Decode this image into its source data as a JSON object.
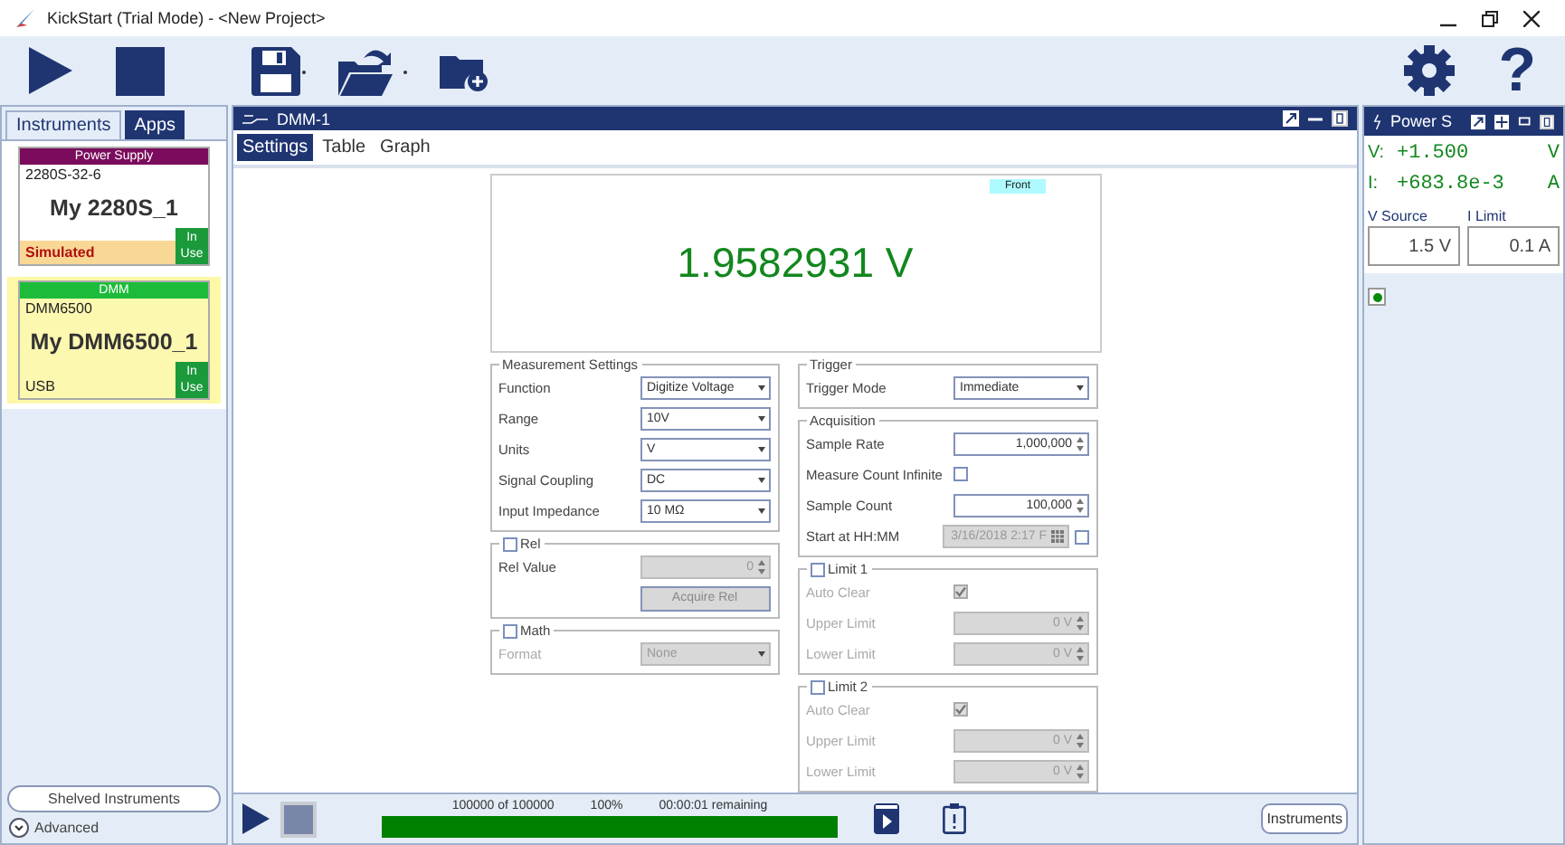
{
  "window": {
    "title": "KickStart (Trial Mode) - <New Project>"
  },
  "toolbar": {
    "help": "?"
  },
  "sidebar": {
    "tabs": [
      {
        "label": "Instruments",
        "selected": true
      },
      {
        "label": "Apps",
        "selected": false
      }
    ],
    "instruments": [
      {
        "category": "Power Supply",
        "color": "#7b0b5c",
        "model": "2280S-32-6",
        "name": "My 2280S_1",
        "connection": "Simulated",
        "simulated": true,
        "status": "In Use",
        "selected": false
      },
      {
        "category": "DMM",
        "color": "#1dbb3a",
        "model": "DMM6500",
        "name": "My DMM6500_1",
        "connection": "USB",
        "simulated": false,
        "status": "In Use",
        "selected": true
      }
    ],
    "shelved_button": "Shelved Instruments",
    "advanced": {
      "label": "Advanced",
      "expanded": false
    }
  },
  "dmm_panel": {
    "title": "DMM-1",
    "tabs": [
      {
        "label": "Settings",
        "selected": true
      },
      {
        "label": "Table",
        "selected": false
      },
      {
        "label": "Graph",
        "selected": false
      }
    ],
    "front_badge": "Front",
    "reading": "1.9582931 V",
    "columns": [
      [
        {
          "title": "Measurement Settings",
          "rows": [
            {
              "kind": "dropdown",
              "label": "Function",
              "value": "Digitize Voltage",
              "disabled": false
            },
            {
              "kind": "dropdown",
              "label": "Range",
              "value": "10V",
              "disabled": false
            },
            {
              "kind": "dropdown",
              "label": "Units",
              "value": "V",
              "disabled": false
            },
            {
              "kind": "dropdown",
              "label": "Signal Coupling",
              "value": "DC",
              "disabled": false
            },
            {
              "kind": "dropdown",
              "label": "Input Impedance",
              "value": "10 MΩ",
              "disabled": false
            }
          ]
        },
        {
          "title": "Rel",
          "checked": false,
          "rows": [
            {
              "kind": "spin",
              "label": "Rel Value",
              "value": "0",
              "disabled": true
            },
            {
              "kind": "button",
              "value": "Acquire Rel",
              "disabled": true
            }
          ]
        },
        {
          "title": "Math",
          "checked": false,
          "rows": [
            {
              "kind": "dropdown",
              "label": "Format",
              "value": "None",
              "disabled": true,
              "label_dimmed": true
            }
          ]
        }
      ],
      [
        {
          "title": "Trigger",
          "rows": [
            {
              "kind": "dropdown",
              "label": "Trigger Mode",
              "value": "Immediate",
              "disabled": false
            }
          ]
        },
        {
          "title": "Acquisition",
          "rows": [
            {
              "kind": "spin",
              "label": "Sample Rate",
              "value": "1,000,000",
              "disabled": false
            },
            {
              "kind": "checkbox",
              "label": "Measure Count Infinite",
              "checked": false,
              "disabled": false
            },
            {
              "kind": "spin",
              "label": "Sample Count",
              "value": "100,000",
              "disabled": false
            },
            {
              "kind": "datetime",
              "label": "Start at HH:MM",
              "value": "3/16/2018 2:17 F",
              "disabled": true,
              "checked": false
            }
          ]
        },
        {
          "title": "Limit 1",
          "checked": false,
          "rows": [
            {
              "kind": "checkbox",
              "label": "Auto Clear",
              "checked": true,
              "disabled": true,
              "label_dimmed": true
            },
            {
              "kind": "spin",
              "label": "Upper Limit",
              "value": "0 V",
              "disabled": true,
              "label_dimmed": true
            },
            {
              "kind": "spin",
              "label": "Lower Limit",
              "value": "0 V",
              "disabled": true,
              "label_dimmed": true
            }
          ]
        },
        {
          "title": "Limit 2",
          "checked": false,
          "rows": [
            {
              "kind": "checkbox",
              "label": "Auto Clear",
              "checked": true,
              "disabled": true,
              "label_dimmed": true
            },
            {
              "kind": "spin",
              "label": "Upper Limit",
              "value": "0 V",
              "disabled": true,
              "label_dimmed": true
            },
            {
              "kind": "spin",
              "label": "Lower Limit",
              "value": "0 V",
              "disabled": true,
              "label_dimmed": true
            }
          ]
        }
      ]
    ],
    "progress": {
      "count": "100000 of 100000",
      "percent": "100%",
      "remaining": "00:00:01 remaining",
      "level": 1
    },
    "instruments_button": "Instruments"
  },
  "power_panel": {
    "title": "Power S",
    "readings": [
      {
        "label": "V:",
        "value": "+1.500",
        "unit": "V"
      },
      {
        "label": "I:",
        "value": "+683.8e-3",
        "unit": "A"
      }
    ],
    "fields": [
      {
        "label": "V Source",
        "value": "1.5 V"
      },
      {
        "label": "I Limit",
        "value": "0.1 A"
      }
    ],
    "output_on": true
  }
}
